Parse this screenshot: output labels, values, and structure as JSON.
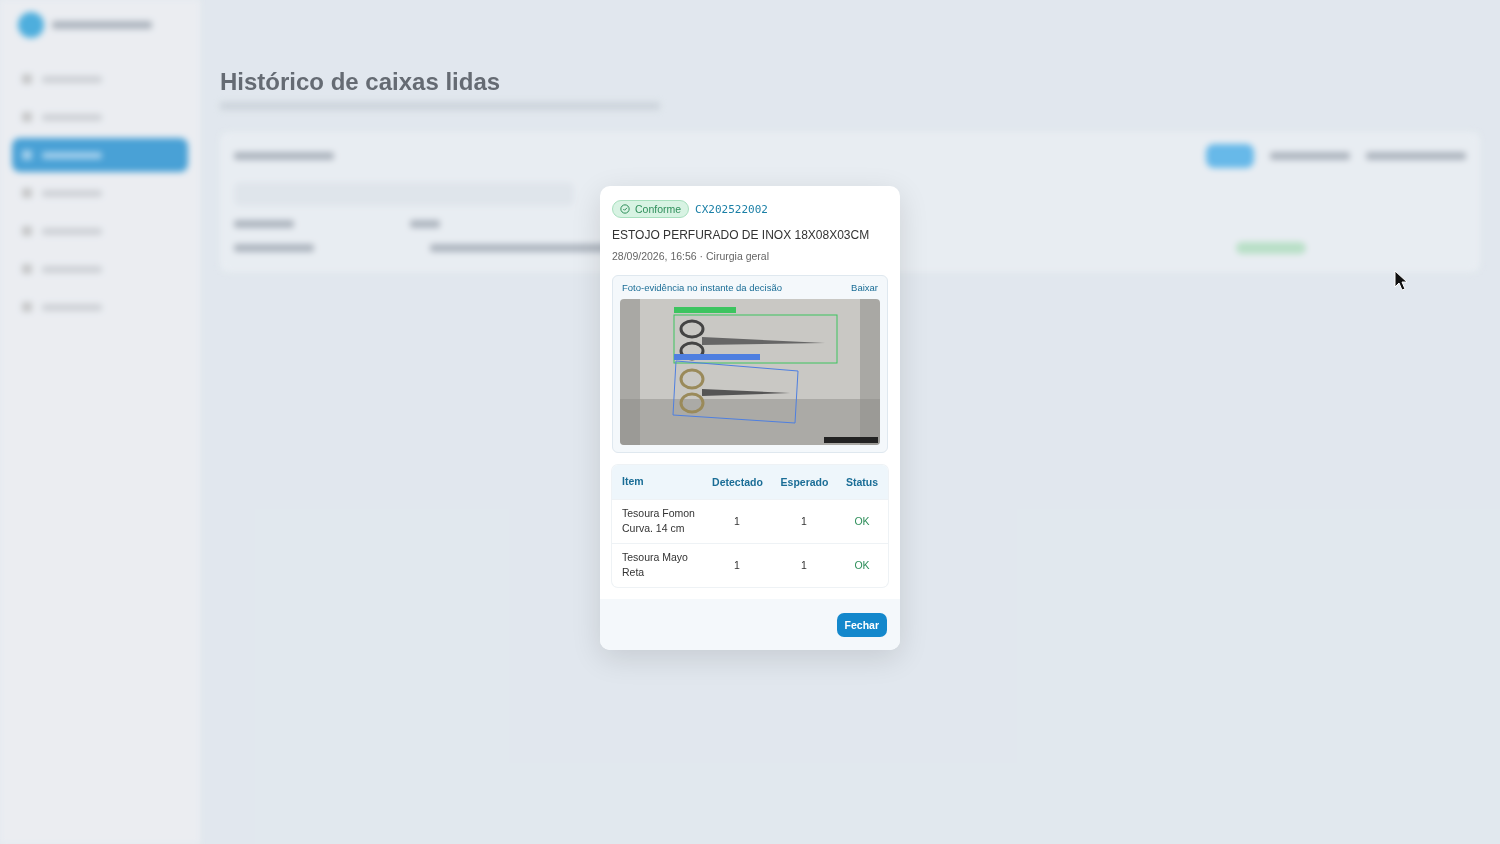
{
  "page": {
    "title": "Histórico de caixas lidas"
  },
  "sidebar": {
    "items": [
      {
        "selected": false
      },
      {
        "selected": false
      },
      {
        "selected": true
      },
      {
        "selected": false
      },
      {
        "selected": false
      },
      {
        "selected": false
      },
      {
        "selected": false
      }
    ]
  },
  "modal": {
    "status": "Conforme",
    "code": "CX202522002",
    "title": "ESTOJO PERFURADO DE INOX 18X08X03CM",
    "meta": "28/09/2026, 16:56 · Cirurgia geral",
    "evidence": {
      "label": "Foto-evidência no instante da decisão",
      "download": "Baixar"
    },
    "table": {
      "columns": [
        "Item",
        "Detectado",
        "Esperado",
        "Status"
      ],
      "rows": [
        {
          "item": "Tesoura Fomon Curva. 14 cm",
          "detected": "1",
          "expected": "1",
          "status": "OK"
        },
        {
          "item": "Tesoura Mayo Reta",
          "detected": "1",
          "expected": "1",
          "status": "OK"
        }
      ]
    },
    "close": "Fechar"
  }
}
